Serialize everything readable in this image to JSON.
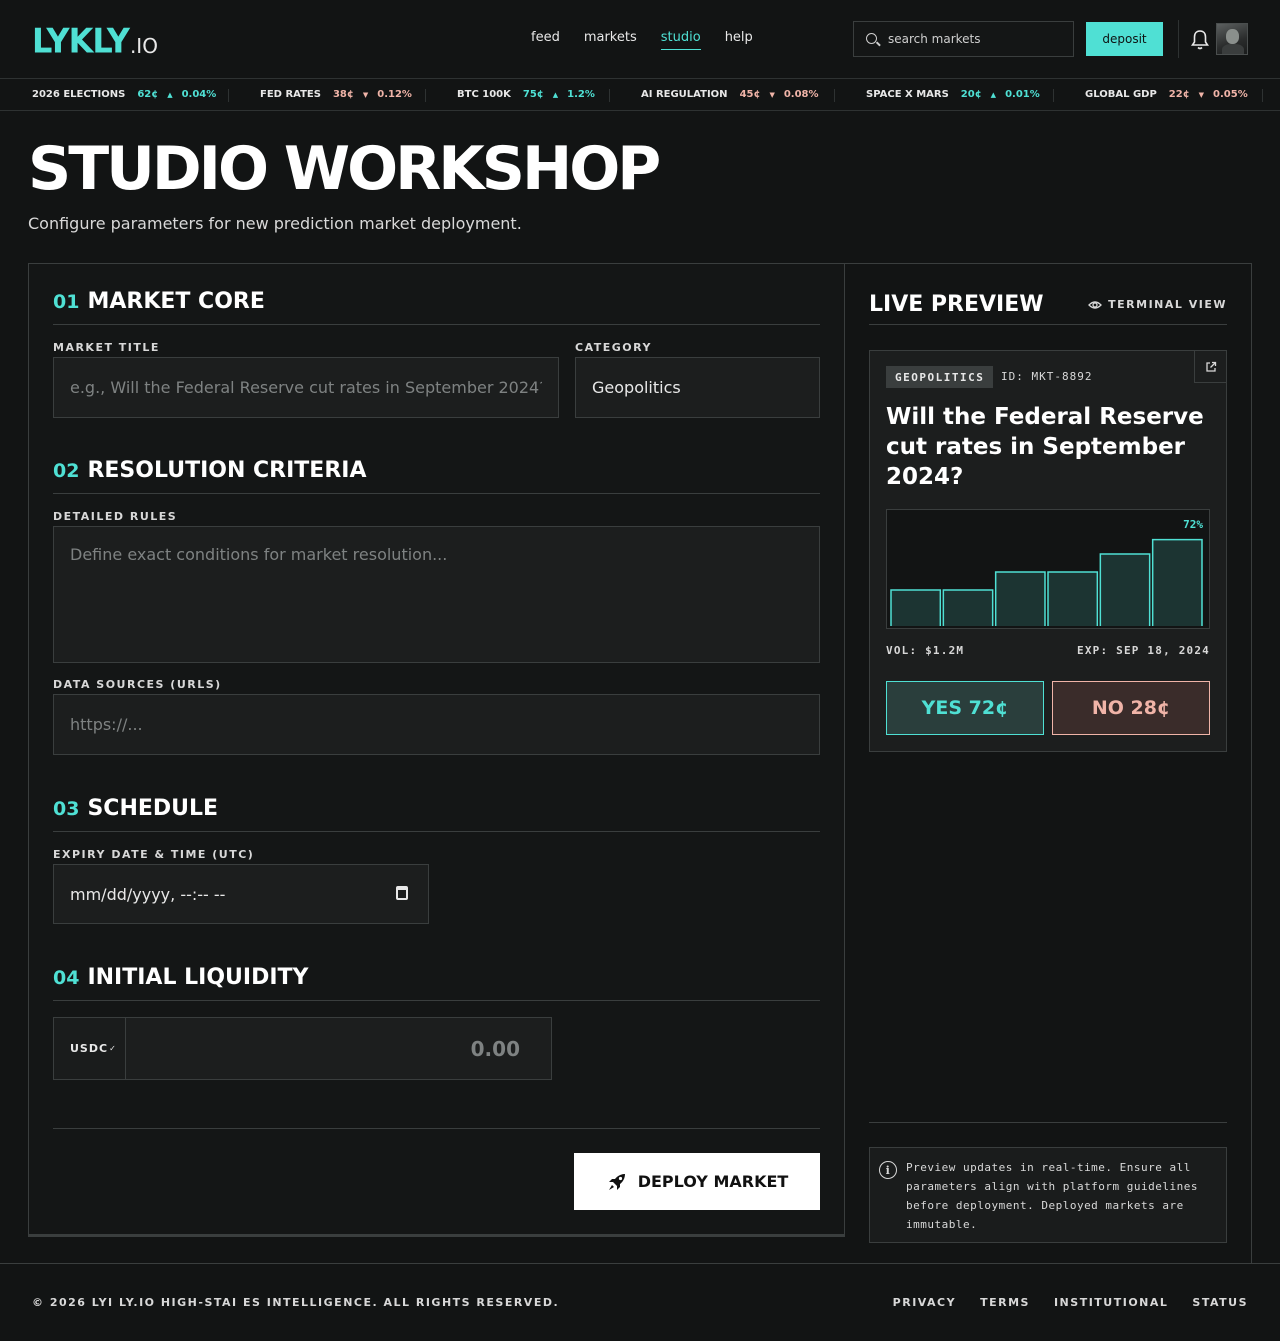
{
  "header": {
    "logo_main": "LYKLY",
    "logo_sub": ".IO",
    "nav": [
      {
        "label": "feed"
      },
      {
        "label": "markets"
      },
      {
        "label": "studio"
      },
      {
        "label": "help"
      }
    ],
    "active_nav": "studio",
    "search_placeholder": "search markets",
    "deposit_label": "deposit"
  },
  "ticker": [
    {
      "name": "2026 ELECTIONS",
      "price": "62¢",
      "direction": "up",
      "change": "0.04%"
    },
    {
      "name": "FED RATES",
      "price": "38¢",
      "direction": "down",
      "change": "0.12%"
    },
    {
      "name": "BTC 100K",
      "price": "75¢",
      "direction": "up",
      "change": "1.2%"
    },
    {
      "name": "AI REGULATION",
      "price": "45¢",
      "direction": "down",
      "change": "0.08%"
    },
    {
      "name": "SPACE X MARS",
      "price": "20¢",
      "direction": "up",
      "change": "0.01%"
    },
    {
      "name": "GLOBAL GDP",
      "price": "22¢",
      "direction": "down",
      "change": "0.05%"
    }
  ],
  "page": {
    "title": "STUDIO WORKSHOP",
    "subtitle": "Configure parameters for new prediction market deployment."
  },
  "form": {
    "sections": [
      {
        "num": "01",
        "title": "MARKET CORE"
      },
      {
        "num": "02",
        "title": "RESOLUTION CRITERIA"
      },
      {
        "num": "03",
        "title": "SCHEDULE"
      },
      {
        "num": "04",
        "title": "INITIAL LIQUIDITY"
      }
    ],
    "market_title_label": "MARKET TITLE",
    "market_title_placeholder": "e.g., Will the Federal Reserve cut rates in September 2024?",
    "category_label": "CATEGORY",
    "category_value": "Geopolitics",
    "rules_label": "DETAILED RULES",
    "rules_placeholder": "Define exact conditions for market resolution...",
    "sources_label": "DATA SOURCES (URLS)",
    "sources_placeholder": "https://...",
    "expiry_label": "EXPIRY DATE & TIME (UTC)",
    "expiry_placeholder": "mm/dd/yyyy, --:-- --",
    "currency": "USDC",
    "liquidity_placeholder": "0.00",
    "deploy_label": "DEPLOY MARKET"
  },
  "preview": {
    "title": "LIVE PREVIEW",
    "terminal_label": "TERMINAL VIEW",
    "category": "GEOPOLITICS",
    "id": "ID: MKT-8892",
    "question": "Will the Federal Reserve cut rates in September 2024?",
    "volume": "VOL: $1.2M",
    "expiry": "EXP: SEP 18, 2024",
    "yes_label": "YES 72¢",
    "no_label": "NO 28¢",
    "note": "Preview updates in real-time. Ensure all parameters align with platform guidelines before deployment. Deployed markets are immutable.",
    "chart_data": {
      "type": "bar",
      "values": [
        30,
        30,
        45,
        45,
        60,
        72
      ],
      "ylim": [
        0,
        85
      ],
      "data_label": "72%",
      "colors": {
        "stroke": "#4fe0d4",
        "fill": "#1c3432"
      }
    }
  },
  "footer": {
    "copyright": "© 2026 LYI LY.IO HIGH-STAI ES INTELLIGENCE. ALL RIGHTS RESERVED.",
    "links": [
      "PRIVACY",
      "TERMS",
      "INSTITUTIONAL",
      "STATUS"
    ]
  },
  "colors": {
    "accent": "#4fe0d4",
    "negative": "#f0b4a8",
    "background": "#121414"
  }
}
